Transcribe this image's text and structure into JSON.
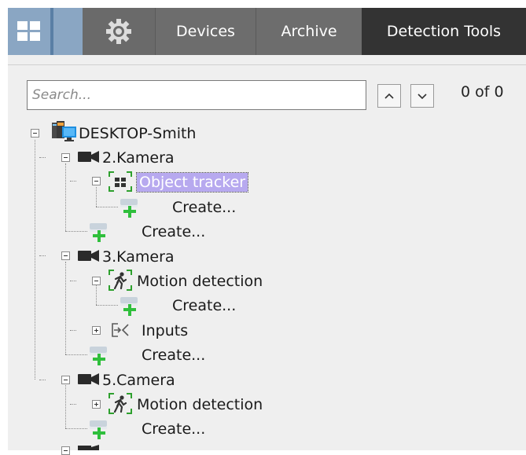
{
  "topbar": {
    "layout_icon": "grid-icon",
    "settings_icon": "gear-icon",
    "tabs": [
      {
        "label": "Devices"
      },
      {
        "label": "Archive"
      },
      {
        "label": "Detection Tools"
      }
    ],
    "colors": {
      "bar": "#6d6d6d",
      "active_tab": "#333333",
      "grid_button": "#8aa6c3"
    }
  },
  "search": {
    "placeholder": "Search...",
    "value": "",
    "prev_icon": "chevron-up-icon",
    "next_icon": "chevron-down-icon",
    "counter": "0 of 0"
  },
  "tree": {
    "root": {
      "label": "DESKTOP-Smith",
      "icon": "server-icon"
    },
    "items": [
      {
        "label": "2.Kamera",
        "icon": "camera-icon"
      },
      {
        "label": "Object tracker",
        "icon": "object-tracker-icon",
        "selected": true
      },
      {
        "label": "Create...",
        "icon": "create-icon"
      },
      {
        "label": "Create...",
        "icon": "create-icon"
      },
      {
        "label": "3.Kamera",
        "icon": "camera-icon"
      },
      {
        "label": "Motion detection",
        "icon": "motion-detection-icon"
      },
      {
        "label": "Create...",
        "icon": "create-icon"
      },
      {
        "label": "Inputs",
        "icon": "inputs-icon"
      },
      {
        "label": "Create...",
        "icon": "create-icon"
      },
      {
        "label": "5.Camera",
        "icon": "camera-icon"
      },
      {
        "label": "Motion detection",
        "icon": "motion-detection-icon"
      },
      {
        "label": "Create...",
        "icon": "create-icon"
      }
    ],
    "selection_color": "#b7a9ef"
  }
}
